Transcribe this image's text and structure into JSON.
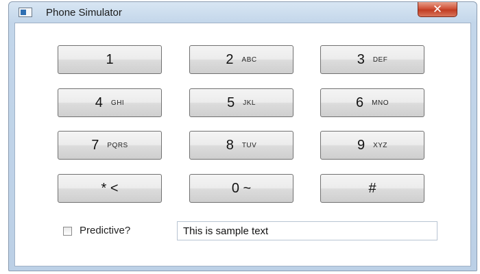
{
  "window": {
    "title": "Phone Simulator",
    "close_label": "✕"
  },
  "keypad": {
    "keys": [
      {
        "digit": "1",
        "letters": ""
      },
      {
        "digit": "2",
        "letters": "ABC"
      },
      {
        "digit": "3",
        "letters": "DEF"
      },
      {
        "digit": "4",
        "letters": "GHI"
      },
      {
        "digit": "5",
        "letters": "JKL"
      },
      {
        "digit": "6",
        "letters": "MNO"
      },
      {
        "digit": "7",
        "letters": "PQRS"
      },
      {
        "digit": "8",
        "letters": "TUV"
      },
      {
        "digit": "9",
        "letters": "XYZ"
      },
      {
        "digit": "* <",
        "letters": ""
      },
      {
        "digit": "0 ~",
        "letters": ""
      },
      {
        "digit": "#",
        "letters": ""
      }
    ]
  },
  "predictive": {
    "label": "Predictive?",
    "checked": false
  },
  "text_field": {
    "value": "This is sample text"
  }
}
